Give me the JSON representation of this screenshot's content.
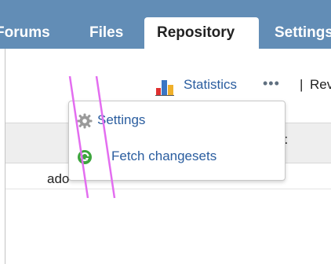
{
  "nav": {
    "tabs": [
      {
        "label": "Forums"
      },
      {
        "label": "Files"
      },
      {
        "label": "Repository",
        "selected": true
      },
      {
        "label": "Settings"
      }
    ]
  },
  "toolbar": {
    "statistics_label": "Statistics",
    "more_label": "•••",
    "separator": "|",
    "revisions_label": "Rev"
  },
  "table": {
    "header_right": "nt",
    "row_text": "ado"
  },
  "dropdown": {
    "items": [
      {
        "label": "Settings",
        "icon": "gear-icon"
      },
      {
        "label": "Fetch changesets",
        "icon": "refresh-icon"
      }
    ]
  },
  "colors": {
    "tabbar": "#628db6",
    "link": "#2a5d9f",
    "annotation": "#e36df0"
  }
}
